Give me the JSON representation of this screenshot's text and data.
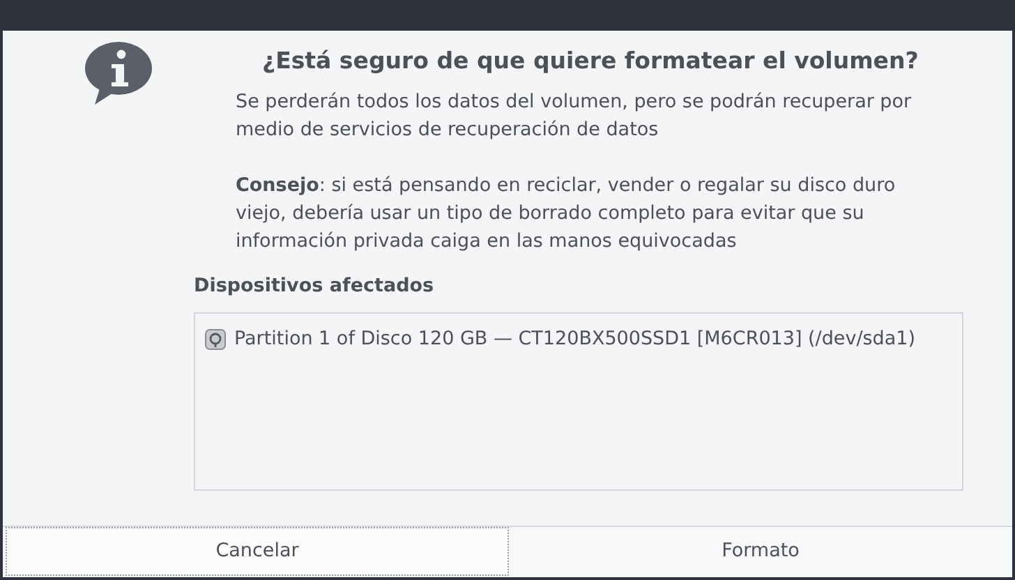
{
  "dialog": {
    "title": "¿Está seguro de que quiere formatear el volumen?",
    "message": "Se perderán todos los datos del volumen, pero se podrán recuperar por medio de servicios de recuperación de datos",
    "tip": "**Consejo**: si está pensando en reciclar, vender o regalar su disco duro viejo, debería usar un tipo de borrado completo para evitar que su información privada caiga en las manos equivocadas"
  },
  "affected_devices": {
    "heading": "Dispositivos afectados",
    "items": [
      {
        "label": "Partition 1 of Disco 120 GB — CT120BX500SSD1 [M6CR013] (/dev/sda1)"
      }
    ]
  },
  "buttons": [
    {
      "label": "Cancelar",
      "focused": true
    },
    {
      "label": "Formato",
      "focused": false
    }
  ]
}
